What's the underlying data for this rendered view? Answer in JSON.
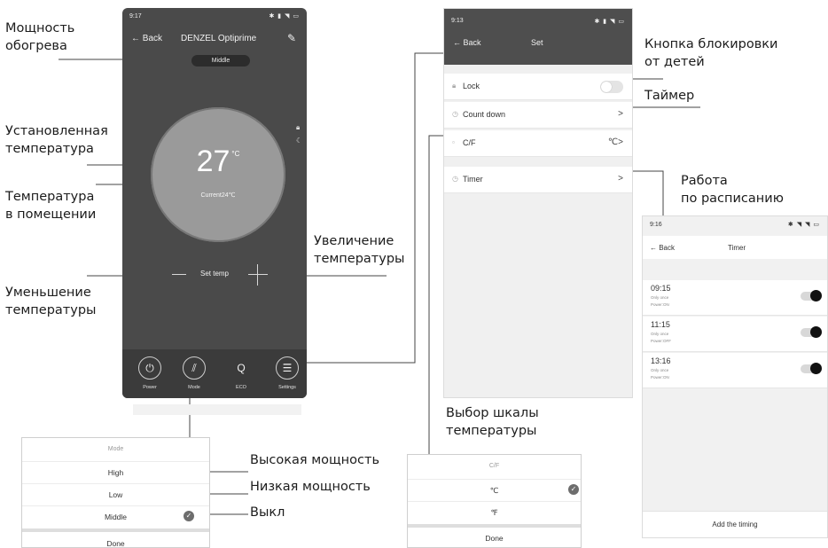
{
  "annotations": {
    "heat_power": [
      "Мощность",
      "обогрева"
    ],
    "set_temperature": [
      "Установленная",
      "температура"
    ],
    "room_temperature": [
      "Температура",
      "в помещении"
    ],
    "temp_increase": [
      "Увеличение",
      "температуры"
    ],
    "temp_decrease": [
      "Уменьшение",
      "температуры"
    ],
    "child_lock": [
      "Кнопка блокировки",
      "от детей"
    ],
    "timer": "Таймер",
    "schedule": [
      "Работа",
      "по расписанию"
    ],
    "scale_select": [
      "Выбор шкалы",
      "температуры"
    ],
    "high_power": "Высокая мощность",
    "low_power": "Низкая мощность",
    "off": "Выкл"
  },
  "main_screen": {
    "status_time": "9:17",
    "status_icons": "✱ ▮ ◥ ▭",
    "back": "← Back",
    "title": "DENZEL Optiprime",
    "edit_icon": "pencil-icon",
    "mode_pill": "Middle",
    "temperature": "27",
    "temperature_unit": "°C",
    "current": "Current24℃",
    "set_temp": "Set temp",
    "side_icons": [
      "lock-icon",
      "moon-icon"
    ],
    "bottom_items": [
      {
        "label": "Power",
        "icon": "power-icon",
        "glyph": "⏻"
      },
      {
        "label": "Mode",
        "icon": "mode-icon",
        "glyph": "⫽"
      },
      {
        "label": "ECO",
        "icon": "eco-icon",
        "glyph": "Q"
      },
      {
        "label": "Settings",
        "icon": "settings-icon",
        "glyph": "☰"
      }
    ]
  },
  "set_screen": {
    "status_time": "9:13",
    "status_icons": "✱ ▮ ◥ ▭",
    "back": "← Back",
    "title": "Set",
    "rows": [
      {
        "label": "Lock",
        "type": "toggle",
        "icon": "lock-icon"
      },
      {
        "label": "Count down",
        "type": "arrow",
        "value": ">",
        "icon": "clock-icon"
      },
      {
        "label": "C/F",
        "type": "arrow",
        "value": "℃>",
        "icon": "scale-icon"
      },
      {
        "label": "Timer",
        "type": "arrow",
        "value": ">",
        "icon": "timer-icon"
      }
    ]
  },
  "timer_screen": {
    "status_time": "9:16",
    "status_icons": "✱ ◥ ◥ ▭",
    "back": "← Back",
    "title": "Timer",
    "timers": [
      {
        "time": "09:15",
        "repeat": "Only once",
        "power": "Power:ON"
      },
      {
        "time": "11:15",
        "repeat": "Only once",
        "power": "Power:OFF"
      },
      {
        "time": "13:16",
        "repeat": "Only once",
        "power": "Power:ON"
      }
    ],
    "add": "Add the timing"
  },
  "mode_popup": {
    "title": "Mode",
    "options": [
      "High",
      "Low",
      "Middle"
    ],
    "selected": "Middle",
    "done": "Done"
  },
  "cf_popup": {
    "title": "C/F",
    "options": [
      "℃",
      "℉"
    ],
    "selected": "℃",
    "done": "Done"
  }
}
